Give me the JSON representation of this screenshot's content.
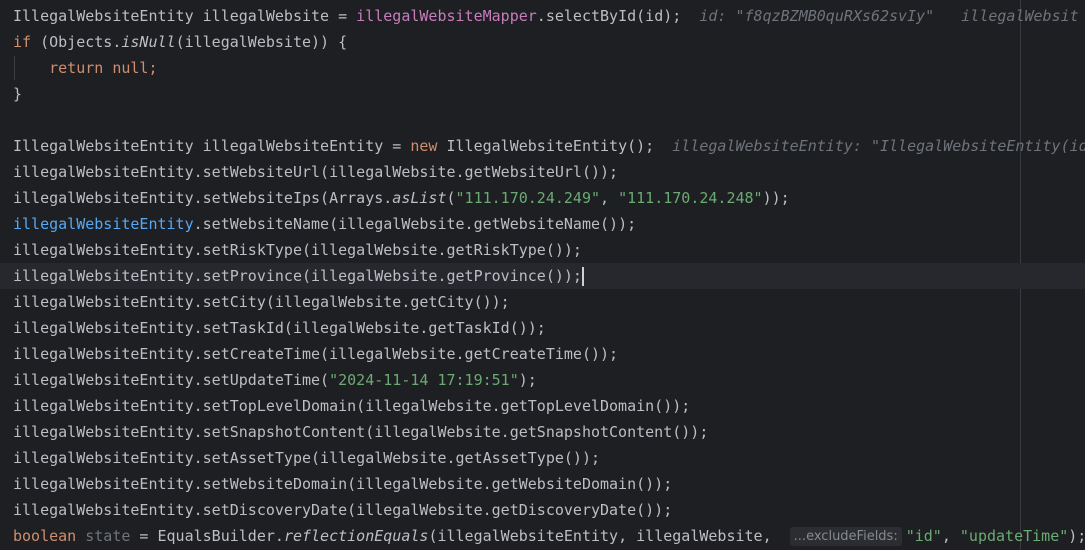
{
  "code": {
    "l1": {
      "a": "IllegalWebsiteEntity illegalWebsite = ",
      "mapper": "illegalWebsiteMapper",
      "b": ".selectById(id);",
      "hint1": "id: \"f8qzBZMB0quRXs62svIy\"",
      "hint2": "illegalWebsit"
    },
    "l2": {
      "kw": "if",
      "a": " (Objects.",
      "method": "isNull",
      "b": "(illegalWebsite)) {"
    },
    "l3": {
      "kw_return": "return",
      "kw_null": "null",
      "semi": ";"
    },
    "l4": {
      "a": "}"
    },
    "l6": {
      "a": "IllegalWebsiteEntity illegalWebsiteEntity = ",
      "kw": "new",
      "b": " IllegalWebsiteEntity();",
      "hint": "illegalWebsiteEntity: \"IllegalWebsiteEntity(id"
    },
    "l7": {
      "a": "illegalWebsiteEntity.setWebsiteUrl(illegalWebsite.getWebsiteUrl());"
    },
    "l8": {
      "a": "illegalWebsiteEntity.setWebsiteIps(Arrays.",
      "method": "asList",
      "b": "(",
      "s1": "\"111.170.24.249\"",
      "c": ", ",
      "s2": "\"111.170.24.248\"",
      "d": "));"
    },
    "l9": {
      "var": "illegalWebsiteEntity",
      "a": ".setWebsiteName(illegalWebsite.getWebsiteName());"
    },
    "l10": {
      "a": "illegalWebsiteEntity.setRiskType(illegalWebsite.getRiskType());"
    },
    "l11": {
      "a": "illegalWebsiteEntity.setProvince(illegalWebsite.getProvince());"
    },
    "l12": {
      "a": "illegalWebsiteEntity.setCity(illegalWebsite.getCity());"
    },
    "l13": {
      "a": "illegalWebsiteEntity.setTaskId(illegalWebsite.getTaskId());"
    },
    "l14": {
      "a": "illegalWebsiteEntity.setCreateTime(illegalWebsite.getCreateTime());"
    },
    "l15": {
      "a": "illegalWebsiteEntity.setUpdateTime(",
      "s": "\"2024-11-14 17:19:51\"",
      "b": ");"
    },
    "l16": {
      "a": "illegalWebsiteEntity.setTopLevelDomain(illegalWebsite.getTopLevelDomain());"
    },
    "l17": {
      "a": "illegalWebsiteEntity.setSnapshotContent(illegalWebsite.getSnapshotContent());"
    },
    "l18": {
      "a": "illegalWebsiteEntity.setAssetType(illegalWebsite.getAssetType());"
    },
    "l19": {
      "a": "illegalWebsiteEntity.setWebsiteDomain(illegalWebsite.getWebsiteDomain());"
    },
    "l20": {
      "a": "illegalWebsiteEntity.setDiscoveryDate(illegalWebsite.getDiscoveryDate());"
    },
    "l21": {
      "kw": "boolean",
      "var": "state",
      "a": " = EqualsBuilder.",
      "method": "reflectionEquals",
      "b": "(illegalWebsiteEntity, illegalWebsite, ",
      "param_hint": "...excludeFields:",
      "s1": "\"id\"",
      "c": ", ",
      "s2": "\"updateTime\"",
      "d": ");"
    }
  },
  "colors": {
    "background": "#1e1f22",
    "text": "#bcbec4",
    "keyword": "#cf8e6d",
    "field": "#c77dbb",
    "string": "#6aab73",
    "inlay_hint": "#6f737a",
    "declaration_highlight": "#56a8f5",
    "current_line": "#26282e"
  }
}
